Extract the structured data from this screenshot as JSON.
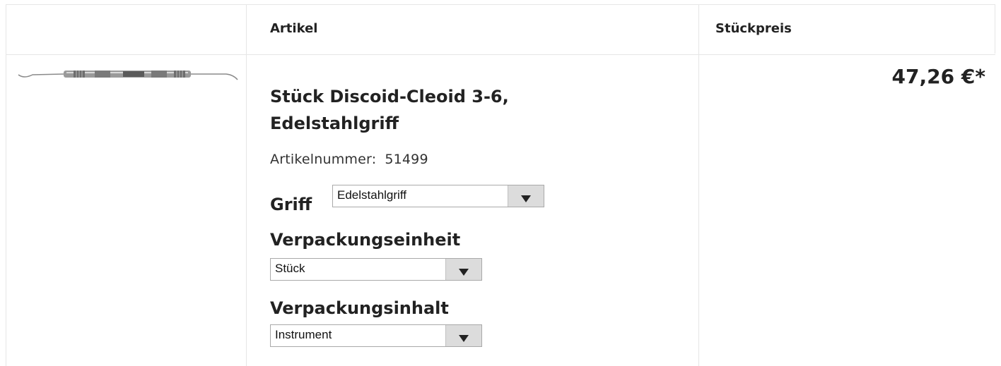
{
  "table": {
    "header": {
      "article_label": "Artikel",
      "unit_price_label": "Stückpreis"
    }
  },
  "product": {
    "image_icon": "dental-instrument-image",
    "title": "Stück Discoid-Cleoid 3-6, Edelstahlgriff",
    "article_number_label": "Artikelnummer:",
    "article_number_value": "51499",
    "options": {
      "grip": {
        "label": "Griff",
        "selected": "Edelstahlgriff"
      },
      "packaging_unit": {
        "label": "Verpackungseinheit",
        "selected": "Stück"
      },
      "packaging_content": {
        "label": "Verpackungsinhalt",
        "selected": "Instrument"
      }
    },
    "price": "47,26 €*"
  },
  "colors": {
    "border": "#e6e6e6",
    "select_button": "#dcdcdc",
    "text": "#222222"
  }
}
